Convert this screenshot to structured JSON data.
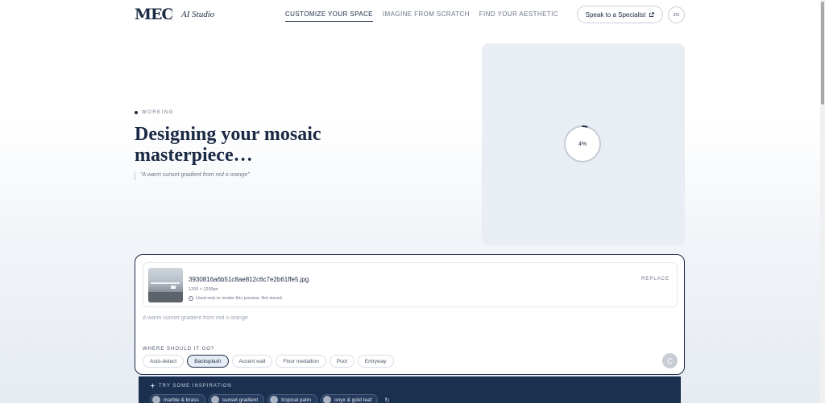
{
  "header": {
    "logo": "MEC",
    "studio": "AI Studio",
    "nav": [
      {
        "label": "CUSTOMIZE YOUR SPACE",
        "active": true
      },
      {
        "label": "IMAGINE FROM SCRATCH",
        "active": false
      },
      {
        "label": "FIND YOUR AESTHETIC",
        "active": false
      }
    ],
    "specialist_label": "Speak to a Specialist",
    "avatar_initials": "ZO"
  },
  "hero": {
    "status": "WORKING",
    "title": "Designing your mosaic masterpiece…",
    "prompt_quote": "\"A warm sunset gradient from red o orange\""
  },
  "preview": {
    "progress_percent": 4,
    "progress_label": "4%"
  },
  "upload": {
    "file_name": "3930816a6b51c8ae812c6c7e2b61ffe5.jpg",
    "file_size": "1200 × 1200px",
    "note": "Used only to render this preview. Not stored.",
    "replace_label": "REPLACE"
  },
  "prompt": {
    "value": "A warm sunset gradient from red o orange"
  },
  "placement": {
    "label": "WHERE SHOULD IT GO?",
    "options": [
      {
        "label": "Auto-detect",
        "active": false
      },
      {
        "label": "Backsplash",
        "active": true
      },
      {
        "label": "Accent wall",
        "active": false
      },
      {
        "label": "Floor medallion",
        "active": false
      },
      {
        "label": "Pool",
        "active": false
      },
      {
        "label": "Entryway",
        "active": false
      }
    ],
    "submit_glyph": "C"
  },
  "inspiration": {
    "label": "TRY SOME INSPIRATION",
    "items": [
      "marble & brass",
      "sunset gradient",
      "tropical palm",
      "onyx & gold leaf"
    ]
  },
  "colors": {
    "primary": "#1b2a45",
    "inspiration_bg": "#1b2f4f",
    "preview_bg": "#e9eef4"
  }
}
